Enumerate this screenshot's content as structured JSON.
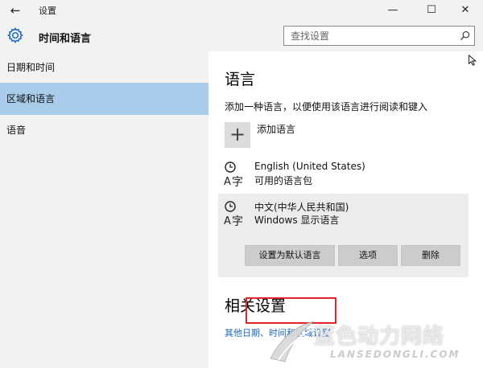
{
  "window": {
    "title": "设置",
    "back_glyph": "←",
    "minimize_glyph": "—",
    "maximize_glyph": "☐",
    "close_glyph": "✕"
  },
  "header": {
    "title": "时间和语言",
    "icon": "gear-icon",
    "search_placeholder": "查找设置",
    "search_value": ""
  },
  "sidebar": {
    "items": [
      {
        "label": "日期和时间",
        "active": false
      },
      {
        "label": "区域和语言",
        "active": true
      },
      {
        "label": "语音",
        "active": false
      }
    ]
  },
  "main": {
    "section_title": "语言",
    "description": "添加一种语言，以便使用该语言进行阅读和键入",
    "add_language": {
      "plus_glyph": "+",
      "label": "添加语言"
    },
    "languages": [
      {
        "name": "English (United States)",
        "status": "可用的语言包",
        "selected": false
      },
      {
        "name": "中文(中华人民共和国)",
        "status": "Windows 显示语言",
        "selected": true
      }
    ],
    "buttons": {
      "set_default": "设置为默认语言",
      "options": "选项",
      "delete": "删除"
    },
    "related_title": "相关设置",
    "related_link": "其他日期、时间和区域设置"
  },
  "watermark": {
    "text": "蓝色动力网络",
    "subtext": "LANSEDONGLI.COM"
  },
  "colors": {
    "nav_active": "#a8cce9",
    "link": "#1b66b8",
    "highlight_border": "#e0252b",
    "chrome_bg": "#f2f2f2"
  }
}
